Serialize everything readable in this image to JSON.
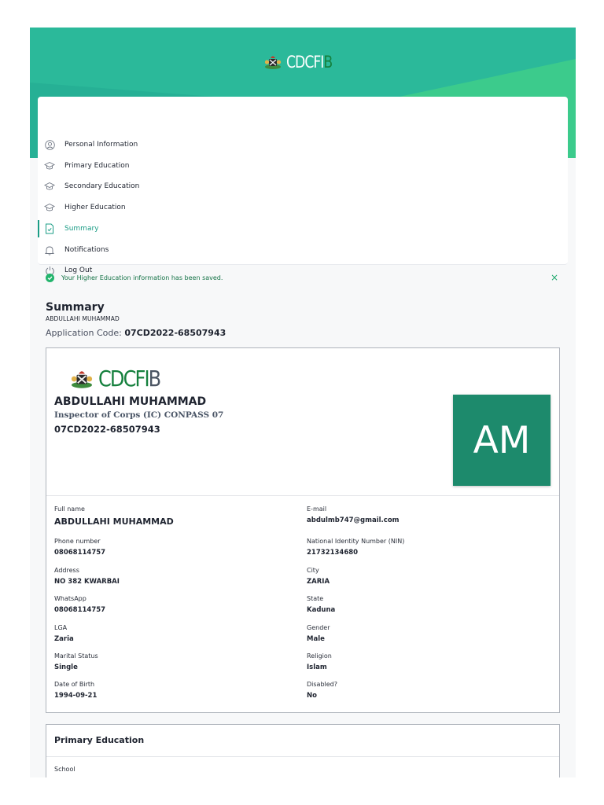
{
  "brand": {
    "name_main": "CDCFI",
    "name_last": "B",
    "colors": {
      "primary": "#2bb99a",
      "accent_green": "#15803d",
      "active": "#1a9c85"
    }
  },
  "nav": {
    "items": [
      {
        "label": "Personal Information",
        "icon": "user-circle-icon",
        "active": false
      },
      {
        "label": "Primary Education",
        "icon": "graduation-cap-icon",
        "active": false
      },
      {
        "label": "Secondary Education",
        "icon": "graduation-cap-icon",
        "active": false
      },
      {
        "label": "Higher Education",
        "icon": "graduation-cap-icon",
        "active": false
      },
      {
        "label": "Summary",
        "icon": "document-check-icon",
        "active": true
      },
      {
        "label": "Notifications",
        "icon": "bell-icon",
        "active": false
      },
      {
        "label": "Log Out",
        "icon": "power-icon",
        "active": false
      }
    ]
  },
  "alert": {
    "message": "Your Higher Education information has been saved.",
    "close_label": "×"
  },
  "summary": {
    "title": "Summary",
    "name": "ABDULLAHI MUHAMMAD",
    "code_label": "Application Code:",
    "code_value": "07CD2022-68507943"
  },
  "card": {
    "logo_main": "CDCFI",
    "logo_last": "B",
    "full_name": "ABDULLAHI MUHAMMAD",
    "rank": "Inspector of Corps (IC) CONPASS 07",
    "code": "07CD2022-68507943",
    "avatar_initials": "AM",
    "fields": [
      {
        "label": "Full name",
        "value": "ABDULLAHI MUHAMMAD"
      },
      {
        "label": "E-mail",
        "value": "abdulmb747@gmail.com"
      },
      {
        "label": "Phone number",
        "value": "08068114757"
      },
      {
        "label": "National Identity Number (NIN)",
        "value": "21732134680"
      },
      {
        "label": "Address",
        "value": "NO 382 KWARBAI"
      },
      {
        "label": "City",
        "value": "ZARIA"
      },
      {
        "label": "WhatsApp",
        "value": "08068114757"
      },
      {
        "label": "State",
        "value": "Kaduna"
      },
      {
        "label": "LGA",
        "value": "Zaria"
      },
      {
        "label": "Gender",
        "value": "Male"
      },
      {
        "label": "Marital Status",
        "value": "Single"
      },
      {
        "label": "Religion",
        "value": "Islam"
      },
      {
        "label": "Date of Birth",
        "value": "1994-09-21"
      },
      {
        "label": "Disabled?",
        "value": "No"
      }
    ]
  },
  "primary_education": {
    "title": "Primary Education",
    "school_label": "School"
  }
}
